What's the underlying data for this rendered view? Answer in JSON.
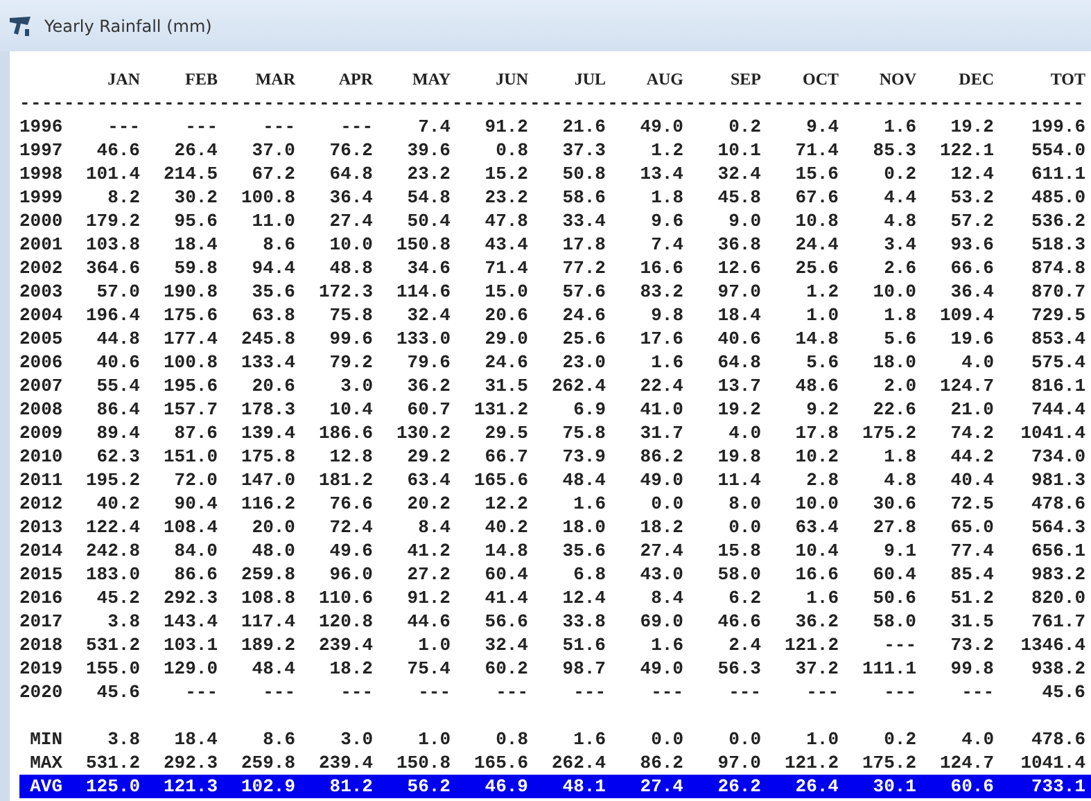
{
  "window": {
    "title": "Yearly Rainfall (mm)"
  },
  "columns": [
    "",
    "JAN",
    "FEB",
    "MAR",
    "APR",
    "MAY",
    "JUN",
    "JUL",
    "AUG",
    "SEP",
    "OCT",
    "NOV",
    "DEC",
    "TOT"
  ],
  "separator": "------------------------------------------------------------------------------------------------",
  "rows": [
    {
      "label": "1996",
      "values": [
        "---",
        "---",
        "---",
        "---",
        "7.4",
        "91.2",
        "21.6",
        "49.0",
        "0.2",
        "9.4",
        "1.6",
        "19.2",
        "199.6"
      ],
      "selected": false
    },
    {
      "label": "1997",
      "values": [
        "46.6",
        "26.4",
        "37.0",
        "76.2",
        "39.6",
        "0.8",
        "37.3",
        "1.2",
        "10.1",
        "71.4",
        "85.3",
        "122.1",
        "554.0"
      ],
      "selected": false
    },
    {
      "label": "1998",
      "values": [
        "101.4",
        "214.5",
        "67.2",
        "64.8",
        "23.2",
        "15.2",
        "50.8",
        "13.4",
        "32.4",
        "15.6",
        "0.2",
        "12.4",
        "611.1"
      ],
      "selected": false
    },
    {
      "label": "1999",
      "values": [
        "8.2",
        "30.2",
        "100.8",
        "36.4",
        "54.8",
        "23.2",
        "58.6",
        "1.8",
        "45.8",
        "67.6",
        "4.4",
        "53.2",
        "485.0"
      ],
      "selected": false
    },
    {
      "label": "2000",
      "values": [
        "179.2",
        "95.6",
        "11.0",
        "27.4",
        "50.4",
        "47.8",
        "33.4",
        "9.6",
        "9.0",
        "10.8",
        "4.8",
        "57.2",
        "536.2"
      ],
      "selected": false
    },
    {
      "label": "2001",
      "values": [
        "103.8",
        "18.4",
        "8.6",
        "10.0",
        "150.8",
        "43.4",
        "17.8",
        "7.4",
        "36.8",
        "24.4",
        "3.4",
        "93.6",
        "518.3"
      ],
      "selected": false
    },
    {
      "label": "2002",
      "values": [
        "364.6",
        "59.8",
        "94.4",
        "48.8",
        "34.6",
        "71.4",
        "77.2",
        "16.6",
        "12.6",
        "25.6",
        "2.6",
        "66.6",
        "874.8"
      ],
      "selected": false
    },
    {
      "label": "2003",
      "values": [
        "57.0",
        "190.8",
        "35.6",
        "172.3",
        "114.6",
        "15.0",
        "57.6",
        "83.2",
        "97.0",
        "1.2",
        "10.0",
        "36.4",
        "870.7"
      ],
      "selected": false
    },
    {
      "label": "2004",
      "values": [
        "196.4",
        "175.6",
        "63.8",
        "75.8",
        "32.4",
        "20.6",
        "24.6",
        "9.8",
        "18.4",
        "1.0",
        "1.8",
        "109.4",
        "729.5"
      ],
      "selected": false
    },
    {
      "label": "2005",
      "values": [
        "44.8",
        "177.4",
        "245.8",
        "99.6",
        "133.0",
        "29.0",
        "25.6",
        "17.6",
        "40.6",
        "14.8",
        "5.6",
        "19.6",
        "853.4"
      ],
      "selected": false
    },
    {
      "label": "2006",
      "values": [
        "40.6",
        "100.8",
        "133.4",
        "79.2",
        "79.6",
        "24.6",
        "23.0",
        "1.6",
        "64.8",
        "5.6",
        "18.0",
        "4.0",
        "575.4"
      ],
      "selected": false
    },
    {
      "label": "2007",
      "values": [
        "55.4",
        "195.6",
        "20.6",
        "3.0",
        "36.2",
        "31.5",
        "262.4",
        "22.4",
        "13.7",
        "48.6",
        "2.0",
        "124.7",
        "816.1"
      ],
      "selected": false
    },
    {
      "label": "2008",
      "values": [
        "86.4",
        "157.7",
        "178.3",
        "10.4",
        "60.7",
        "131.2",
        "6.9",
        "41.0",
        "19.2",
        "9.2",
        "22.6",
        "21.0",
        "744.4"
      ],
      "selected": false
    },
    {
      "label": "2009",
      "values": [
        "89.4",
        "87.6",
        "139.4",
        "186.6",
        "130.2",
        "29.5",
        "75.8",
        "31.7",
        "4.0",
        "17.8",
        "175.2",
        "74.2",
        "1041.4"
      ],
      "selected": false
    },
    {
      "label": "2010",
      "values": [
        "62.3",
        "151.0",
        "175.8",
        "12.8",
        "29.2",
        "66.7",
        "73.9",
        "86.2",
        "19.8",
        "10.2",
        "1.8",
        "44.2",
        "734.0"
      ],
      "selected": false
    },
    {
      "label": "2011",
      "values": [
        "195.2",
        "72.0",
        "147.0",
        "181.2",
        "63.4",
        "165.6",
        "48.4",
        "49.0",
        "11.4",
        "2.8",
        "4.8",
        "40.4",
        "981.3"
      ],
      "selected": false
    },
    {
      "label": "2012",
      "values": [
        "40.2",
        "90.4",
        "116.2",
        "76.6",
        "20.2",
        "12.2",
        "1.6",
        "0.0",
        "8.0",
        "10.0",
        "30.6",
        "72.5",
        "478.6"
      ],
      "selected": false
    },
    {
      "label": "2013",
      "values": [
        "122.4",
        "108.4",
        "20.0",
        "72.4",
        "8.4",
        "40.2",
        "18.0",
        "18.2",
        "0.0",
        "63.4",
        "27.8",
        "65.0",
        "564.3"
      ],
      "selected": false
    },
    {
      "label": "2014",
      "values": [
        "242.8",
        "84.0",
        "48.0",
        "49.6",
        "41.2",
        "14.8",
        "35.6",
        "27.4",
        "15.8",
        "10.4",
        "9.1",
        "77.4",
        "656.1"
      ],
      "selected": false
    },
    {
      "label": "2015",
      "values": [
        "183.0",
        "86.6",
        "259.8",
        "96.0",
        "27.2",
        "60.4",
        "6.8",
        "43.0",
        "58.0",
        "16.6",
        "60.4",
        "85.4",
        "983.2"
      ],
      "selected": false
    },
    {
      "label": "2016",
      "values": [
        "45.2",
        "292.3",
        "108.8",
        "110.6",
        "91.2",
        "41.4",
        "12.4",
        "8.4",
        "6.2",
        "1.6",
        "50.6",
        "51.2",
        "820.0"
      ],
      "selected": false
    },
    {
      "label": "2017",
      "values": [
        "3.8",
        "143.4",
        "117.4",
        "120.8",
        "44.6",
        "56.6",
        "33.8",
        "69.0",
        "46.6",
        "36.2",
        "58.0",
        "31.5",
        "761.7"
      ],
      "selected": false
    },
    {
      "label": "2018",
      "values": [
        "531.2",
        "103.1",
        "189.2",
        "239.4",
        "1.0",
        "32.4",
        "51.6",
        "1.6",
        "2.4",
        "121.2",
        "---",
        "73.2",
        "1346.4"
      ],
      "selected": false
    },
    {
      "label": "2019",
      "values": [
        "155.0",
        "129.0",
        "48.4",
        "18.2",
        "75.4",
        "60.2",
        "98.7",
        "49.0",
        "56.3",
        "37.2",
        "111.1",
        "99.8",
        "938.2"
      ],
      "selected": false
    },
    {
      "label": "2020",
      "values": [
        "45.6",
        "---",
        "---",
        "---",
        "---",
        "---",
        "---",
        "---",
        "---",
        "---",
        "---",
        "---",
        "45.6"
      ],
      "selected": false
    }
  ],
  "summary_rows": [
    {
      "label": "MIN",
      "values": [
        "3.8",
        "18.4",
        "8.6",
        "3.0",
        "1.0",
        "0.8",
        "1.6",
        "0.0",
        "0.0",
        "1.0",
        "0.2",
        "4.0",
        "478.6"
      ],
      "selected": false
    },
    {
      "label": "MAX",
      "values": [
        "531.2",
        "292.3",
        "259.8",
        "239.4",
        "150.8",
        "165.6",
        "262.4",
        "86.2",
        "97.0",
        "121.2",
        "175.2",
        "124.7",
        "1041.4"
      ],
      "selected": false
    },
    {
      "label": "AVG",
      "values": [
        "125.0",
        "121.3",
        "102.9",
        "81.2",
        "56.2",
        "46.9",
        "48.1",
        "27.4",
        "26.2",
        "26.4",
        "30.1",
        "60.6",
        "733.1"
      ],
      "selected": true
    }
  ]
}
